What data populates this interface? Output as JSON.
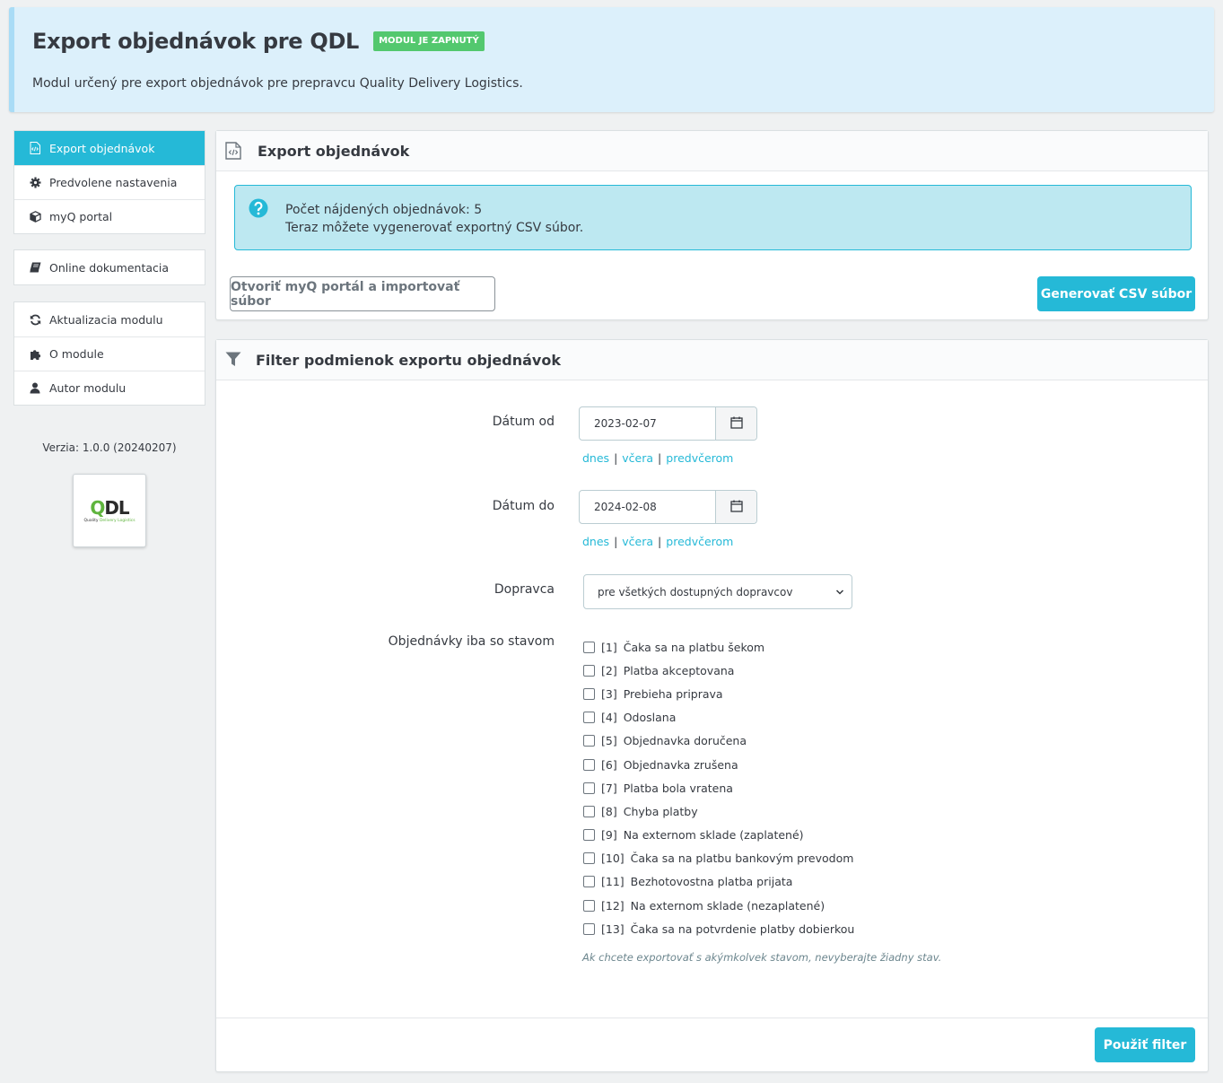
{
  "header": {
    "title": "Export objednávok pre QDL",
    "badge": "MODUL JE ZAPNUTÝ",
    "description": "Modul určený pre export objednávok pre prepravcu Quality Delivery Logistics."
  },
  "sidebar": {
    "group1": [
      {
        "label": "Export objednávok",
        "icon": "file-code-icon",
        "active": true
      },
      {
        "label": "Predvolene nastavenia",
        "icon": "gear-icon",
        "active": false
      },
      {
        "label": "myQ portal",
        "icon": "cube-icon",
        "active": false
      }
    ],
    "group2": [
      {
        "label": "Online dokumentacia",
        "icon": "book-icon",
        "active": false
      }
    ],
    "group3": [
      {
        "label": "Aktualizacia modulu",
        "icon": "refresh-icon",
        "active": false
      },
      {
        "label": "O module",
        "icon": "puzzle-icon",
        "active": false
      },
      {
        "label": "Autor modulu",
        "icon": "user-icon",
        "active": false
      }
    ],
    "version": "Verzia: 1.0.0 (20240207)",
    "logo": {
      "main_q": "Q",
      "main_rest": "DL",
      "sub_1": "Quality ",
      "sub_2": "Delivery Logistics"
    }
  },
  "export_panel": {
    "title": "Export objednávok",
    "alert_line1": "Počet nájdených objednávok: 5",
    "alert_line2": "Teraz môžete vygenerovať exportný CSV súbor.",
    "open_portal_button": "Otvoriť myQ portál a importovať súbor",
    "generate_button": "Generovať CSV súbor"
  },
  "filter_panel": {
    "title": "Filter podmienok exportu objednávok",
    "date_from": {
      "label": "Dátum od",
      "value": "2023-02-07"
    },
    "date_to": {
      "label": "Dátum do",
      "value": "2024-02-08"
    },
    "quick": {
      "today": "dnes",
      "yesterday": "včera",
      "before_yesterday": "predvčerom",
      "sep": "|"
    },
    "carrier": {
      "label": "Dopravca",
      "value": "pre všetkých dostupných dopravcov"
    },
    "status_label": "Objednávky iba so stavom",
    "statuses": [
      {
        "code": "[1]",
        "name": "Čaka sa na platbu šekom"
      },
      {
        "code": "[2]",
        "name": "Platba akceptovana"
      },
      {
        "code": "[3]",
        "name": "Prebieha priprava"
      },
      {
        "code": "[4]",
        "name": "Odoslana"
      },
      {
        "code": "[5]",
        "name": "Objednavka doručena"
      },
      {
        "code": "[6]",
        "name": "Objednavka zrušena"
      },
      {
        "code": "[7]",
        "name": "Platba bola vratena"
      },
      {
        "code": "[8]",
        "name": "Chyba platby"
      },
      {
        "code": "[9]",
        "name": "Na externom sklade (zaplatené)"
      },
      {
        "code": "[10]",
        "name": "Čaka sa na platbu bankovým prevodom"
      },
      {
        "code": "[11]",
        "name": "Bezhotovostna platba prijata"
      },
      {
        "code": "[12]",
        "name": "Na externom sklade (nezaplatené)"
      },
      {
        "code": "[13]",
        "name": "Čaka sa na potvrdenie platby dobierkou"
      }
    ],
    "hint": "Ak chcete exportovať s akýmkolvek stavom, nevyberajte žiadny stav.",
    "apply_button": "Použiť filter"
  },
  "colors": {
    "accent": "#25b9d7",
    "badge": "#53c86e",
    "header_bg": "#dcf0fb"
  }
}
